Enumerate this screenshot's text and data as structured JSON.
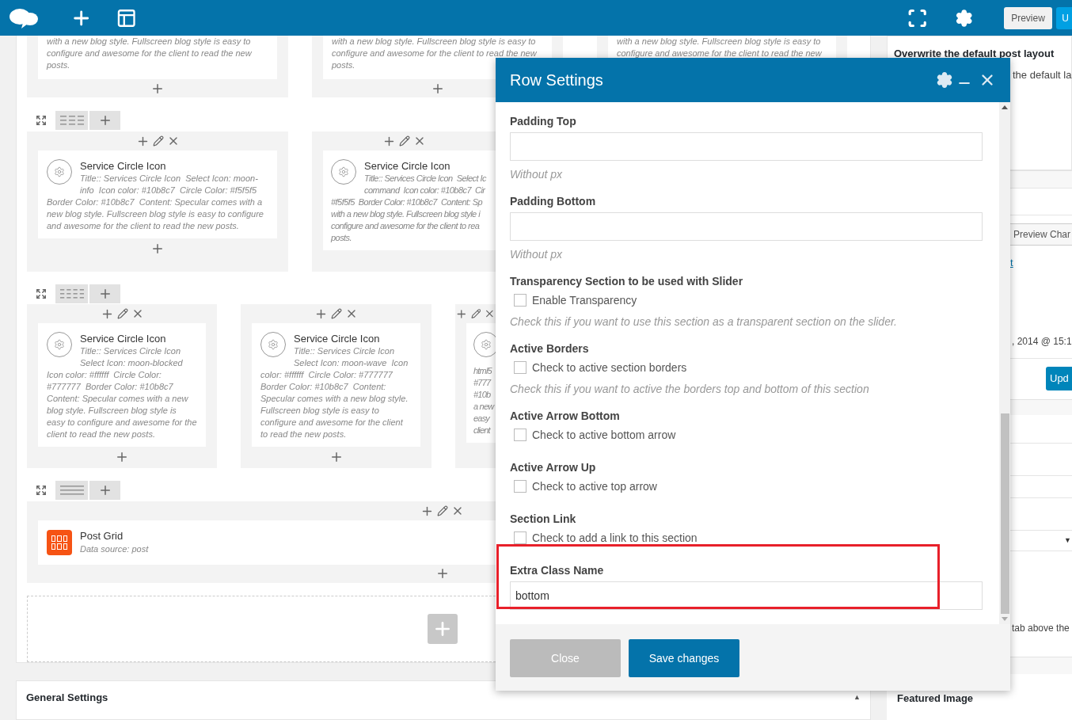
{
  "topbar": {
    "preview_button": "Preview",
    "update_button": "U"
  },
  "builder": {
    "rows": [
      {
        "columns": [
          {
            "kind": "lines",
            "lines": [
              "with a new blog style. Fullscreen blog style is easy to",
              "configure and awesome for the client to read the new",
              "posts."
            ]
          },
          {
            "kind": "lines",
            "lines": [
              "with a new blog style. Fullscreen blog style is easy to",
              "configure and awesome for the client to read the new",
              "posts."
            ]
          },
          {
            "kind": "lines",
            "lines": [
              "with a new blog style. Fullscreen blog style is easy to",
              "configure and awesome for the client to read the new"
            ]
          }
        ]
      },
      {
        "kind": "three_columns",
        "columns": [
          {
            "kind": "service",
            "title": "Service Circle Icon",
            "description": "Title:: Services Circle Icon  Select Icon: moon-info  Icon color: #10b8c7  Circle Color: #f5f5f5  Border Color: #10b8c7  Content: Specular comes with a new blog style. Fullscreen blog style is easy to configure and awesome for the client to read the new posts."
          },
          {
            "kind": "service_cut",
            "title": "Service Circle Icon",
            "lines": [
              "Title:: Services Circle Icon  Select Ic",
              "command  Icon color: #10b8c7  Cir",
              "#f5f5f5  Border Color: #10b8c7  Content: Sp",
              "with a new blog style. Fullscreen blog style i",
              "configure and awesome for the client to rea",
              "posts."
            ]
          }
        ]
      },
      {
        "kind": "four_columns",
        "columns": [
          {
            "kind": "service",
            "title": "Service Circle Icon",
            "description": "Title:: Services Circle Icon  Select Icon: moon-blocked  Icon color: #ffffff  Circle Color: #777777  Border Color: #10b8c7  Content: Specular comes with a new blog style. Fullscreen blog style is easy to configure and awesome for the client to read the new posts."
          },
          {
            "kind": "service",
            "title": "Service Circle Icon",
            "description": "Title:: Services Circle Icon  Select Icon: moon-wave  Icon color: #ffffff  Circle Color: #777777  Border Color: #10b8c7  Content: Specular comes with a new blog style. Fullscreen blog style is easy to configure and awesome for the client to read the new posts."
          },
          {
            "kind": "service_cut",
            "lines": [
              "html5",
              "#777",
              "#10b",
              "a new",
              "easy",
              "client"
            ]
          }
        ]
      },
      {
        "kind": "one_column",
        "columns": [
          {
            "kind": "post_grid",
            "title": "Post Grid",
            "description": "Data source: post"
          }
        ]
      }
    ]
  },
  "general_settings": {
    "title": "General Settings",
    "toggle": "▲"
  },
  "sidebar": {
    "title": "Overwrite the default post layout",
    "texts": [
      "the default la",
      "Preview Char",
      "t",
      ", 2014 @ 15:1",
      "Upd",
      "▼",
      "tab above the",
      "Featured Image"
    ]
  },
  "modal": {
    "title": "Row Settings",
    "fields": [
      {
        "kind": "text",
        "label": "Padding Top",
        "hint": "Without px"
      },
      {
        "kind": "text",
        "label": "Padding Bottom",
        "hint": "Without px"
      },
      {
        "kind": "checkbox",
        "label": "Transparency Section to be used with Slider",
        "option": "Enable Transparency",
        "checked": false,
        "hint": "Check this if you want to use this section as a transparent section on the slider."
      },
      {
        "kind": "checkbox",
        "label": "Active Borders",
        "option": "Check to active section borders",
        "checked": false,
        "hint": "Check this if you want to active the borders top and bottom of this section"
      },
      {
        "kind": "checkbox",
        "label": "Active Arrow Bottom",
        "option": "Check to active bottom arrow",
        "checked": false
      },
      {
        "kind": "checkbox",
        "label": "Active Arrow Up",
        "option": "Check to active top arrow",
        "checked": false
      },
      {
        "kind": "checkbox",
        "label": "Section Link",
        "option": "Check to add a link to this section",
        "checked": false
      },
      {
        "kind": "text",
        "label": "Extra Class Name",
        "value": "bottom",
        "highlighted": true
      }
    ],
    "buttons": [
      {
        "kind": "secondary",
        "label": "Close"
      },
      {
        "kind": "primary",
        "label": "Save changes"
      }
    ]
  }
}
